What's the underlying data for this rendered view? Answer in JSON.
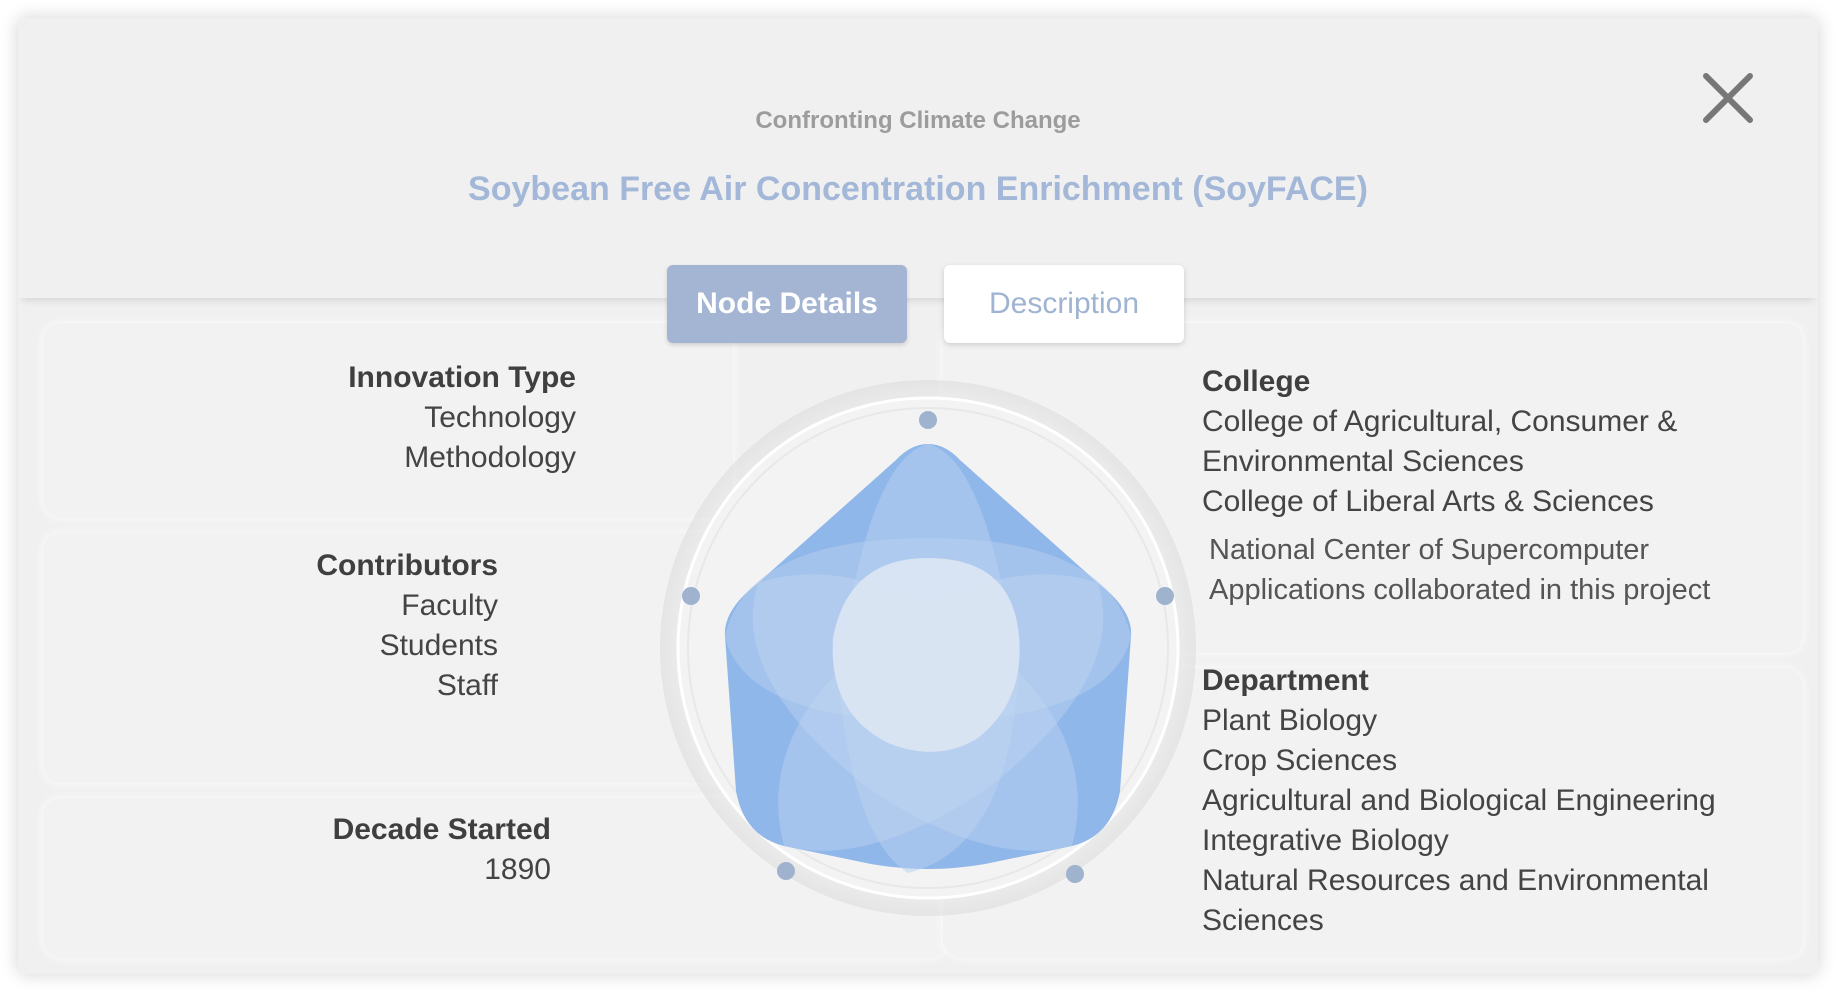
{
  "header": {
    "subtitle": "Confronting Climate Change",
    "title": "Soybean Free Air Concentration Enrichment (SoyFACE)"
  },
  "tabs": [
    {
      "label": "Node Details",
      "active": true
    },
    {
      "label": "Description",
      "active": false
    }
  ],
  "innovation_type": {
    "heading": "Innovation Type",
    "items": [
      "Technology",
      "Methodology"
    ]
  },
  "contributors": {
    "heading": "Contributors",
    "items": [
      "Faculty",
      "Students",
      "Staff"
    ]
  },
  "decade_started": {
    "heading": "Decade Started",
    "value": "1890"
  },
  "college": {
    "heading": "College",
    "items": [
      "College of Agricultural, Consumer &",
      "Environmental Sciences",
      "College of Liberal Arts & Sciences"
    ],
    "note_lines": [
      "National Center of Supercomputer",
      "Applications collaborated in this project"
    ]
  },
  "department": {
    "heading": "Department",
    "items": [
      "Plant Biology",
      "Crop Sciences",
      "Agricultural and Biological Engineering",
      "Integrative Biology",
      "Natural Resources and Environmental",
      "Sciences"
    ]
  },
  "colors": {
    "accent": "#a3b5d3",
    "title": "#a3b7d8",
    "radar_fill": "#8ab3e8",
    "radar_dot": "#9fb3cf"
  }
}
